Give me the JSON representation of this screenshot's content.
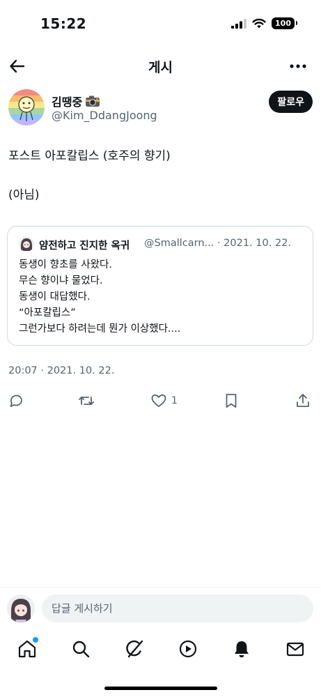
{
  "status_bar": {
    "time": "15:22",
    "battery": "100"
  },
  "header": {
    "title": "게시"
  },
  "author": {
    "name": "김땡중",
    "handle": "@Kim_DdangJoong",
    "follow_label": "팔로우"
  },
  "post": {
    "text": "포스트 아포칼립스 (호주의 향기)\n\n(아님)"
  },
  "quote": {
    "name": "얌전하고 진지한 옥귀",
    "handle": "@Smallcarn...",
    "date": "· 2021. 10. 22.",
    "lines": [
      "동생이 향초를 사왔다.",
      "무슨 향이냐 물었다.",
      "동생이 대답했다.",
      "“아포칼립스”",
      "그런가보다 하려는데 뭔가 이상했다...."
    ]
  },
  "timestamp": "20:07 · 2021. 10. 22.",
  "actions": {
    "like_count": "1"
  },
  "reply": {
    "placeholder": "답글 게시하기"
  },
  "icons": [
    "back-arrow-icon",
    "more-icon",
    "camera-icon",
    "reply-icon",
    "retweet-icon",
    "like-icon",
    "bookmark-icon",
    "share-icon",
    "home-icon",
    "search-icon",
    "grok-icon",
    "video-icon",
    "notifications-icon",
    "messages-icon"
  ],
  "colors": {
    "accent": "#1d9bf0",
    "text": "#0f1419",
    "secondary": "#536471",
    "border": "#cfd9de"
  }
}
